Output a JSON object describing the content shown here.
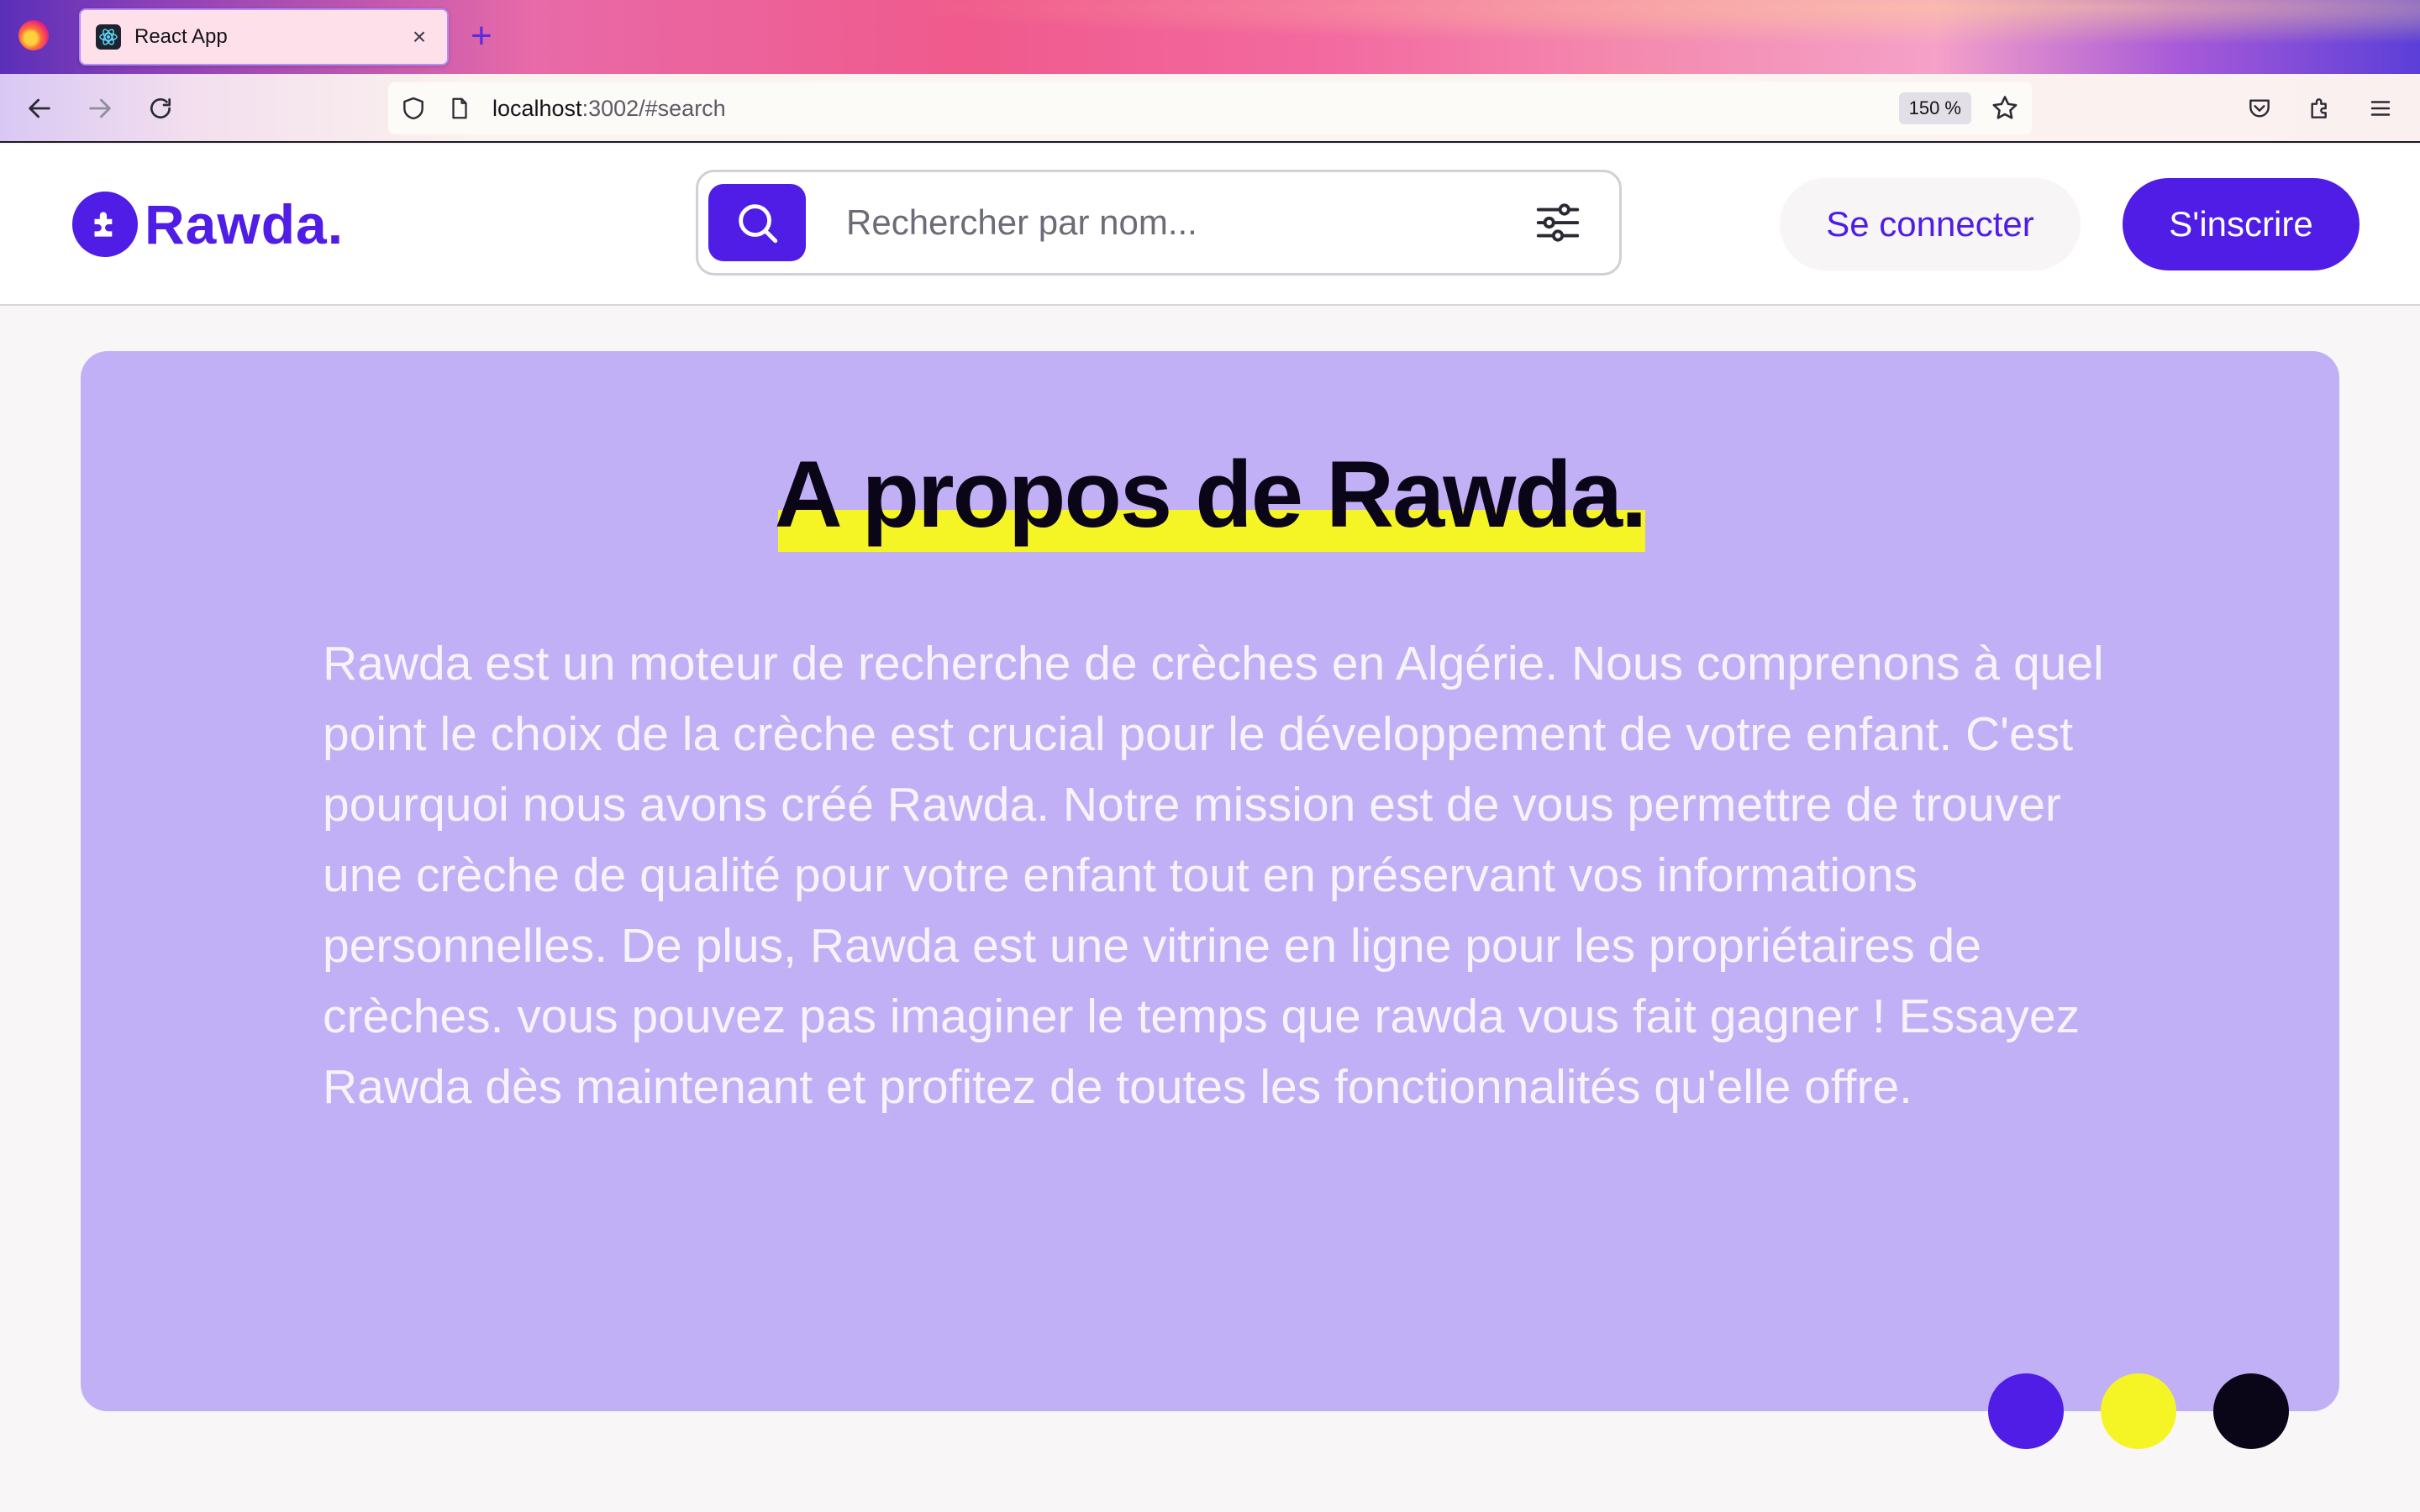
{
  "browser": {
    "tab_title": "React App",
    "tab_close": "×",
    "new_tab": "+",
    "url_host": "localhost",
    "url_rest": ":3002/#search",
    "zoom": "150 %"
  },
  "header": {
    "logo_text": "Rawda.",
    "search_placeholder": "Rechercher par nom...",
    "login_label": "Se connecter",
    "signup_label": "S'inscrire"
  },
  "about": {
    "title": "A propos de Rawda.",
    "body": "Rawda est un moteur de recherche de crèches en Algérie. Nous comprenons à quel point le choix de la crèche est crucial pour le développement de votre enfant. C'est pourquoi nous avons créé Rawda. Notre mission est de vous permettre de trouver une crèche de qualité pour votre enfant tout en préservant vos informations personnelles. De plus, Rawda est une vitrine en ligne pour les propriétaires de crèches. vous pouvez pas imaginer le temps que rawda vous fait gagner ! Essayez Rawda dès maintenant et profitez de toutes les fonctionnalités qu'elle offre."
  },
  "colors": {
    "brand": "#4f1de6",
    "accent_yellow": "#f5f526",
    "card_bg": "#c1b0f5",
    "dark": "#0b0518"
  },
  "icons": {
    "browser_logo": "firefox-icon",
    "tab_favicon": "react-icon",
    "back": "arrow-left-icon",
    "forward": "arrow-right-icon",
    "reload": "reload-icon",
    "shield": "shield-icon",
    "page": "page-icon",
    "bookmark": "star-icon",
    "pocket": "pocket-icon",
    "extensions": "puzzle-icon",
    "menu": "hamburger-icon",
    "logo": "puzzle-logo-icon",
    "search": "search-icon",
    "filter": "sliders-icon"
  }
}
